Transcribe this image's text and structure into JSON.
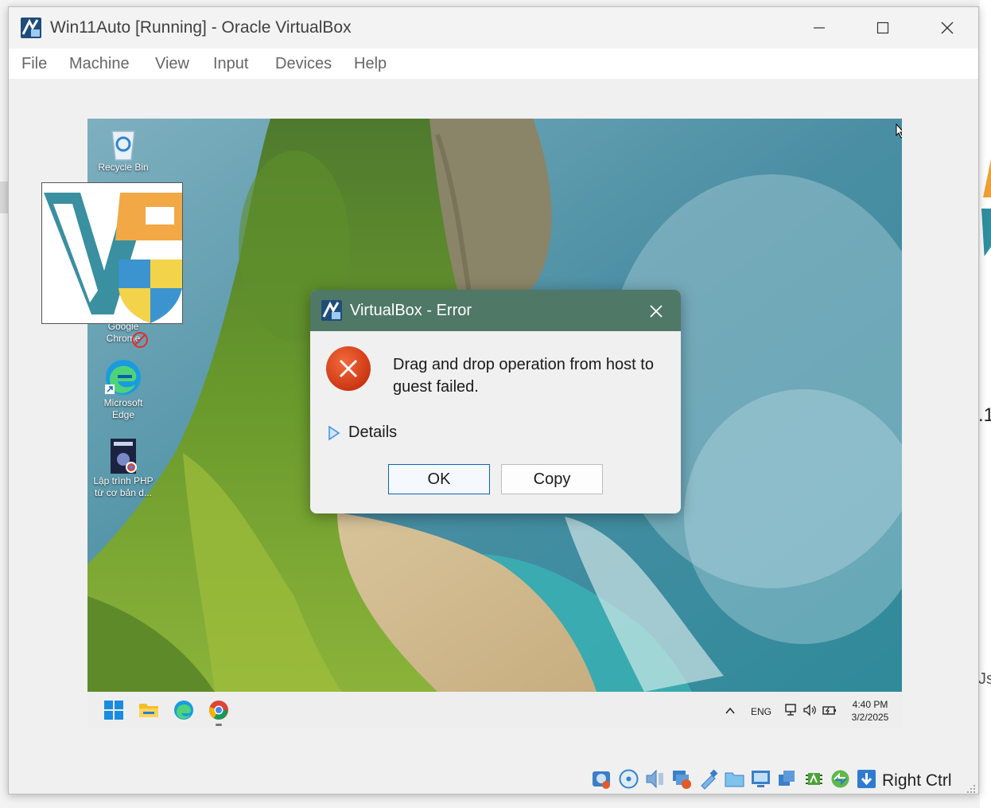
{
  "window": {
    "title": "Win11Auto [Running] - Oracle VirtualBox"
  },
  "menu": [
    "File",
    "Machine",
    "View",
    "Input",
    "Devices",
    "Help"
  ],
  "desktop": {
    "icons": [
      {
        "label": "Recycle Bin"
      },
      {
        "label": "Google Chrome"
      },
      {
        "label": "Microsoft Edge"
      },
      {
        "label": "Lập trình PHP từ cơ bản d..."
      }
    ]
  },
  "dialog": {
    "title": "VirtualBox - Error",
    "message": "Drag and drop operation from host to guest failed.",
    "details_label": "Details",
    "ok_label": "OK",
    "copy_label": "Copy"
  },
  "taskbar": {
    "language": "ENG",
    "time": "4:40 PM",
    "date": "3/2/2025"
  },
  "statusbar": {
    "host_key": "Right Ctrl"
  },
  "background_fragments": {
    "text1": ".1",
    "text2": "Js"
  },
  "colors": {
    "dialog_titlebar": "#4f7866",
    "error_icon": "#e0401e",
    "ok_border": "#0a64c0"
  }
}
